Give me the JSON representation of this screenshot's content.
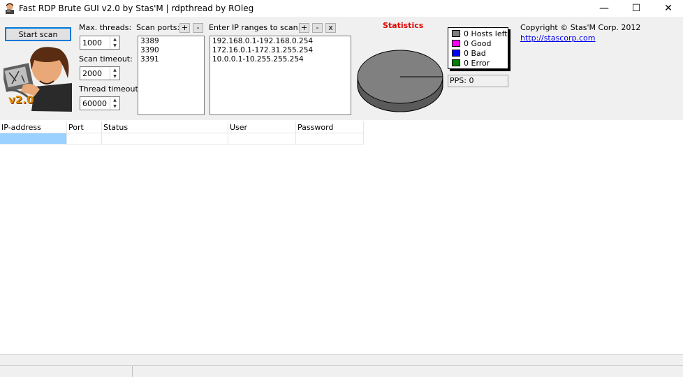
{
  "window": {
    "title": "Fast RDP Brute GUI v2.0 by Stas'M | rdpthread by ROleg",
    "minimize_glyph": "—",
    "maximize_glyph": "☐",
    "close_glyph": "✕"
  },
  "toolbar": {
    "start_scan_label": "Start scan",
    "logo_text": "v2.0",
    "max_threads_label": "Max. threads:",
    "max_threads_value": "1000",
    "scan_timeout_label": "Scan timeout:",
    "scan_timeout_value": "2000",
    "thread_timeout_label": "Thread timeout:",
    "thread_timeout_value": "60000",
    "scan_ports_label": "Scan ports:",
    "ports": [
      "3389",
      "3390",
      "3391"
    ],
    "ip_ranges_label": "Enter IP ranges to scan:",
    "ip_ranges": [
      "192.168.0.1-192.168.0.254",
      "172.16.0.1-172.31.255.254",
      "10.0.0.1-10.255.255.254"
    ],
    "add_glyph": "+",
    "remove_glyph": "-",
    "clear_glyph": "x"
  },
  "statistics": {
    "title": "Statistics",
    "legend": [
      {
        "label": "0 Hosts left",
        "color": "#808080"
      },
      {
        "label": "0 Good",
        "color": "#ff00ff"
      },
      {
        "label": "0 Bad",
        "color": "#0000ff"
      },
      {
        "label": "0 Error",
        "color": "#008000"
      }
    ],
    "pps_label": "PPS: 0",
    "pie_color": "#808080"
  },
  "about": {
    "copyright": "Copyright © Stas'M Corp. 2012",
    "link": "http://stascorp.com"
  },
  "results_table": {
    "columns": [
      "IP-address",
      "Port",
      "Status",
      "User",
      "Password"
    ],
    "rows": [],
    "selected_color": "#99d1ff"
  }
}
